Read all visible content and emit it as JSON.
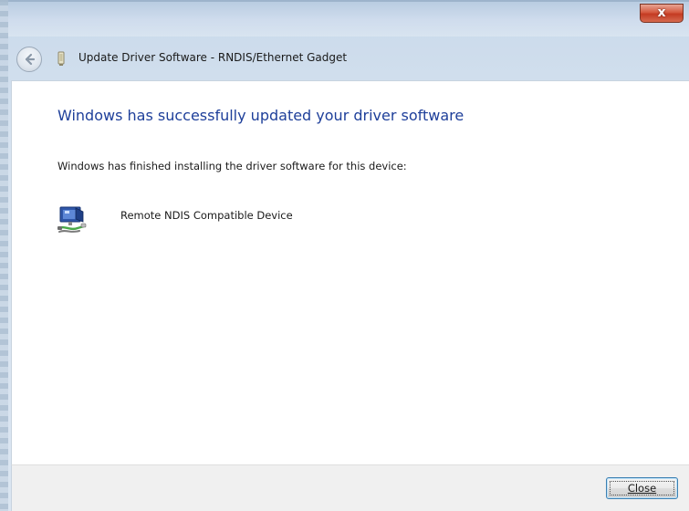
{
  "window": {
    "title": "Update Driver Software - RNDIS/Ethernet Gadget",
    "close_glyph": "x"
  },
  "content": {
    "heading": "Windows has successfully updated your driver software",
    "info": "Windows has finished installing the driver software for this device:",
    "device_name": "Remote NDIS Compatible Device"
  },
  "footer": {
    "close_label": "Close"
  },
  "icons": {
    "back": "back-arrow-icon",
    "title_device": "device-icon",
    "network_device": "network-adapter-icon"
  },
  "colors": {
    "heading": "#1e3f9a",
    "close_button_border": "#3c7fb1",
    "titlebar_close": "#c43a22"
  }
}
